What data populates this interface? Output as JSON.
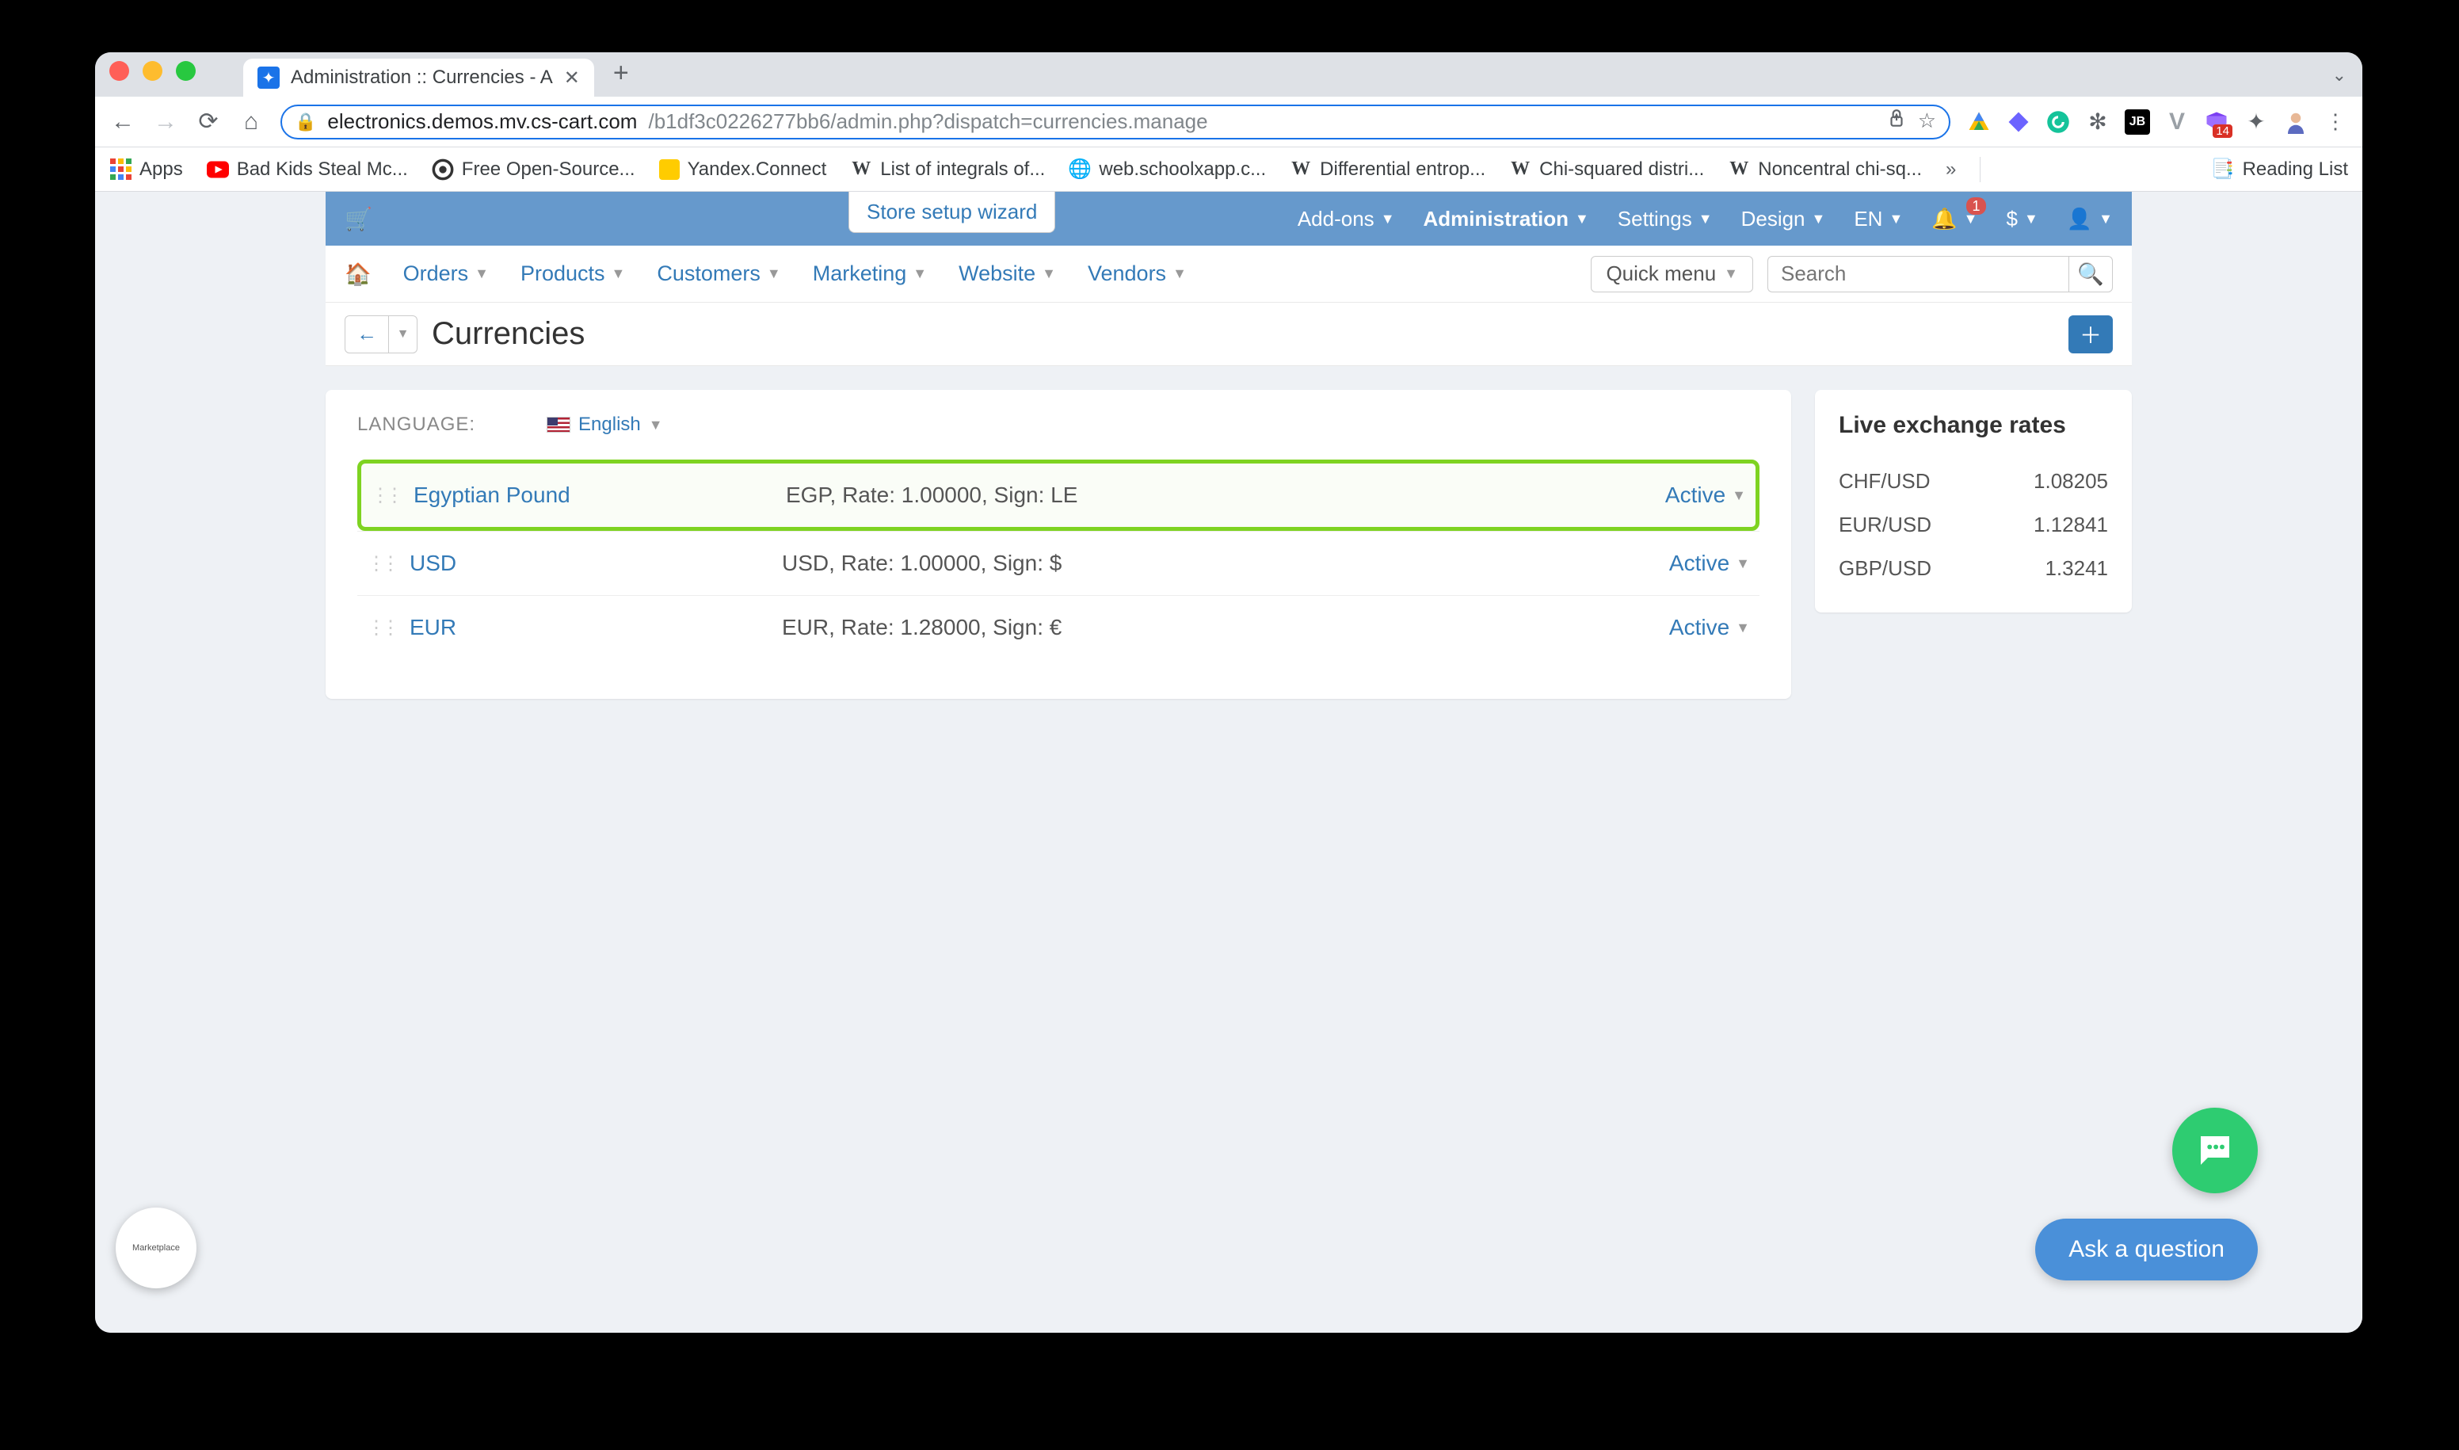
{
  "browser": {
    "tab_title": "Administration :: Currencies - A",
    "url_secure_part": "electronics.demos.mv.cs-cart.com",
    "url_path": "/b1df3c0226277bb6/admin.php?dispatch=currencies.manage",
    "purple_ext_badge": "14"
  },
  "bookmarks": {
    "apps": "Apps",
    "items": [
      "Bad Kids Steal Mc...",
      "Free Open-Source...",
      "Yandex.Connect",
      "List of integrals of...",
      "web.schoolxapp.c...",
      "Differential entrop...",
      "Chi-squared distri...",
      "Noncentral chi-sq..."
    ],
    "reading_list": "Reading List"
  },
  "bluebar": {
    "setup_wizard": "Store setup wizard",
    "items": [
      "Add-ons",
      "Administration",
      "Settings",
      "Design",
      "EN",
      "$"
    ],
    "bell_badge": "1"
  },
  "whitebar": {
    "items": [
      "Orders",
      "Products",
      "Customers",
      "Marketing",
      "Website",
      "Vendors"
    ],
    "quick_menu": "Quick menu",
    "search_placeholder": "Search"
  },
  "titlebar": {
    "title": "Currencies"
  },
  "main": {
    "language_label": "LANGUAGE:",
    "language_value": "English",
    "currencies": [
      {
        "name": "Egyptian Pound",
        "detail": "EGP, Rate: 1.00000, Sign: LE",
        "status": "Active",
        "highlight": true
      },
      {
        "name": "USD",
        "detail": "USD, Rate: 1.00000, Sign: $",
        "status": "Active",
        "highlight": false
      },
      {
        "name": "EUR",
        "detail": "EUR, Rate: 1.28000, Sign: €",
        "status": "Active",
        "highlight": false
      }
    ]
  },
  "sidebar": {
    "title": "Live exchange rates",
    "rates": [
      {
        "pair": "CHF/USD",
        "value": "1.08205"
      },
      {
        "pair": "EUR/USD",
        "value": "1.12841"
      },
      {
        "pair": "GBP/USD",
        "value": "1.3241"
      }
    ]
  },
  "floating": {
    "ask": "Ask a question"
  }
}
